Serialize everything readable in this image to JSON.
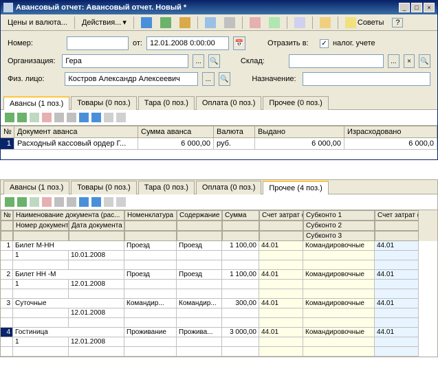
{
  "window": {
    "title": "Авансовый отчет: Авансовый отчет. Новый *"
  },
  "toolbar": {
    "currency": "Цены и валюта...",
    "actions": "Действия...",
    "tips": "Советы"
  },
  "form": {
    "number_label": "Номер:",
    "from_label": "от:",
    "date_value": "12.01.2008 0:00:00",
    "reflect_label": "Отразить в:",
    "tax_label": "налог. учете",
    "org_label": "Организация:",
    "org_value": "Гера",
    "warehouse_label": "Склад:",
    "person_label": "Физ. лицо:",
    "person_value": "Костров Александр Алексеевич",
    "purpose_label": "Назначение:"
  },
  "tabs1": [
    "Авансы (1 поз.)",
    "Товары (0 поз.)",
    "Тара (0 поз.)",
    "Оплата (0 поз.)",
    "Прочее (0 поз.)"
  ],
  "grid1": {
    "headers": {
      "num": "№",
      "doc": "Документ аванса",
      "sum": "Сумма аванса",
      "cur": "Валюта",
      "issued": "Выдано",
      "spent": "Израсходовано"
    },
    "row": {
      "num": "1",
      "doc": "Расходный кассовый ордер Г...",
      "sum": "6 000,00",
      "cur": "руб.",
      "issued": "6 000,00",
      "spent": "6 000,0"
    }
  },
  "tabs2": [
    "Авансы (1 поз.)",
    "Товары (0 поз.)",
    "Тара (0 поз.)",
    "Оплата (0 поз.)",
    "Прочее (4 поз.)"
  ],
  "grid2": {
    "headers": {
      "num": "№",
      "docname": "Наименование документа (рас...",
      "docnum": "Номер документа",
      "docdate": "Дата документа",
      "nomen": "Номенклатура",
      "content": "Содержание",
      "sum": "Сумма",
      "acct_bu": "Счет затрат (БУ)",
      "sub1": "Субконто 1",
      "sub2": "Субконто 2",
      "sub3": "Субконто 3",
      "acct_nu": "Счет затрат (НУ)"
    },
    "rows": [
      {
        "n": "1",
        "name": "Билет М-НН",
        "num": "1",
        "date": "10.01.2008",
        "nomen": "Проезд",
        "content": "Проезд",
        "sum": "1 100,00",
        "bu": "44.01",
        "sub": "Командировочные",
        "nu": "44.01"
      },
      {
        "n": "2",
        "name": "Билет НН -М",
        "num": "1",
        "date": "12.01.2008",
        "nomen": "Проезд",
        "content": "Проезд",
        "sum": "1 100,00",
        "bu": "44.01",
        "sub": "Командировочные",
        "nu": "44.01"
      },
      {
        "n": "3",
        "name": "Суточные",
        "num": "",
        "date": "12.01.2008",
        "nomen": "Командир...",
        "content": "Командир...",
        "sum": "300,00",
        "bu": "44.01",
        "sub": "Командировочные",
        "nu": "44.01"
      },
      {
        "n": "4",
        "name": "Гостиница",
        "num": "1",
        "date": "12.01.2008",
        "nomen": "Проживание",
        "content": "Прожива...",
        "sum": "3 000,00",
        "bu": "44.01",
        "sub": "Командировочные",
        "nu": "44.01"
      }
    ]
  }
}
